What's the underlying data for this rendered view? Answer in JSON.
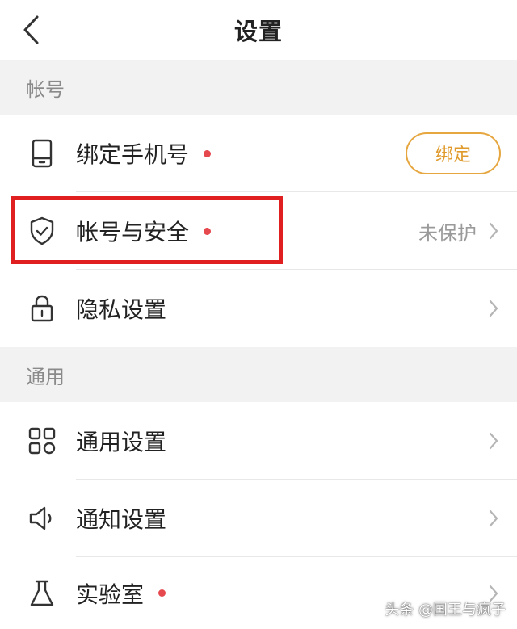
{
  "header": {
    "title": "设置"
  },
  "sections": [
    {
      "title": "帐号"
    },
    {
      "title": "通用"
    }
  ],
  "account": {
    "bind_phone": {
      "label": "绑定手机号",
      "button": "绑定",
      "has_dot": true
    },
    "security": {
      "label": "帐号与安全",
      "status": "未保护",
      "has_dot": true
    },
    "privacy": {
      "label": "隐私设置"
    }
  },
  "general": {
    "general_settings": {
      "label": "通用设置"
    },
    "notifications": {
      "label": "通知设置"
    },
    "lab": {
      "label": "实验室",
      "has_dot": true
    }
  },
  "colors": {
    "accent": "#e6a640",
    "dot": "#e5484d",
    "highlight": "#e02020"
  },
  "watermark": "头条 @国王与疯子"
}
